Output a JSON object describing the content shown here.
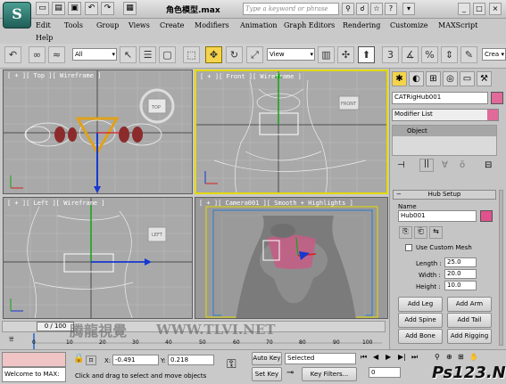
{
  "window": {
    "title": "角色模型.max",
    "search_placeholder": "Type a keyword or phrase"
  },
  "menu": [
    "Edit",
    "Tools",
    "Group",
    "Views",
    "Create",
    "Modifiers",
    "Animation",
    "Graph Editors",
    "Rendering",
    "Customize",
    "MAXScript",
    "Help"
  ],
  "toolbar": {
    "selection_filter": "All",
    "ref_coord": "View",
    "named_set": "Crea"
  },
  "viewports": {
    "top": "[ + ][ Top ][ Wireframe ]",
    "front": "[ + ][ Front ][ Wireframe ]",
    "left": "[ + ][ Left ][ Wireframe ]",
    "camera": "[ + ][ Camera001 ][ Smooth + Highlights ]",
    "cube_top": "TOP",
    "cube_front": "FRONT",
    "cube_left": "LEFT"
  },
  "command_panel": {
    "object_name": "CATRigHub001",
    "modifier_list": "Modifier List",
    "stack_item": "Object",
    "rollout_title": "Hub Setup",
    "name_label": "Name",
    "name_value": "Hub001",
    "use_custom_mesh": "Use Custom Mesh",
    "length_label": "Length :",
    "length_value": "25.0",
    "width_label": "Width :",
    "width_value": "20.0",
    "height_label": "Height :",
    "height_value": "10.0",
    "buttons": [
      "Add Leg",
      "Add Arm",
      "Add Spine",
      "Add Tail",
      "Add Bone",
      "Add Rigging"
    ],
    "colors": {
      "object_swatch": "#e06a9a",
      "name_swatch": "#e0528c"
    }
  },
  "timeline": {
    "frame_label": "0 / 100",
    "ticks": [
      "0",
      "10",
      "20",
      "30",
      "40",
      "50",
      "60",
      "70",
      "80",
      "90",
      "100"
    ]
  },
  "status": {
    "welcome": "Welcome to MAX:",
    "x_label": "X:",
    "x_value": "-0.491",
    "y_label": "Y:",
    "y_value": "0.218",
    "auto_key": "Auto Key",
    "set_key": "Set Key",
    "selected": "Selected",
    "key_filters": "Key Filters...",
    "prompt": "Click and drag to select and move objects",
    "frame": "0"
  },
  "watermarks": {
    "left": "腾龍視覺",
    "center": "WWW.TLVI.NET",
    "right": "Ps123.Net"
  },
  "accent": {
    "active_border": "#e4d900",
    "axis_x": "#d62020",
    "axis_y": "#13a313",
    "axis_z": "#1638d0"
  }
}
